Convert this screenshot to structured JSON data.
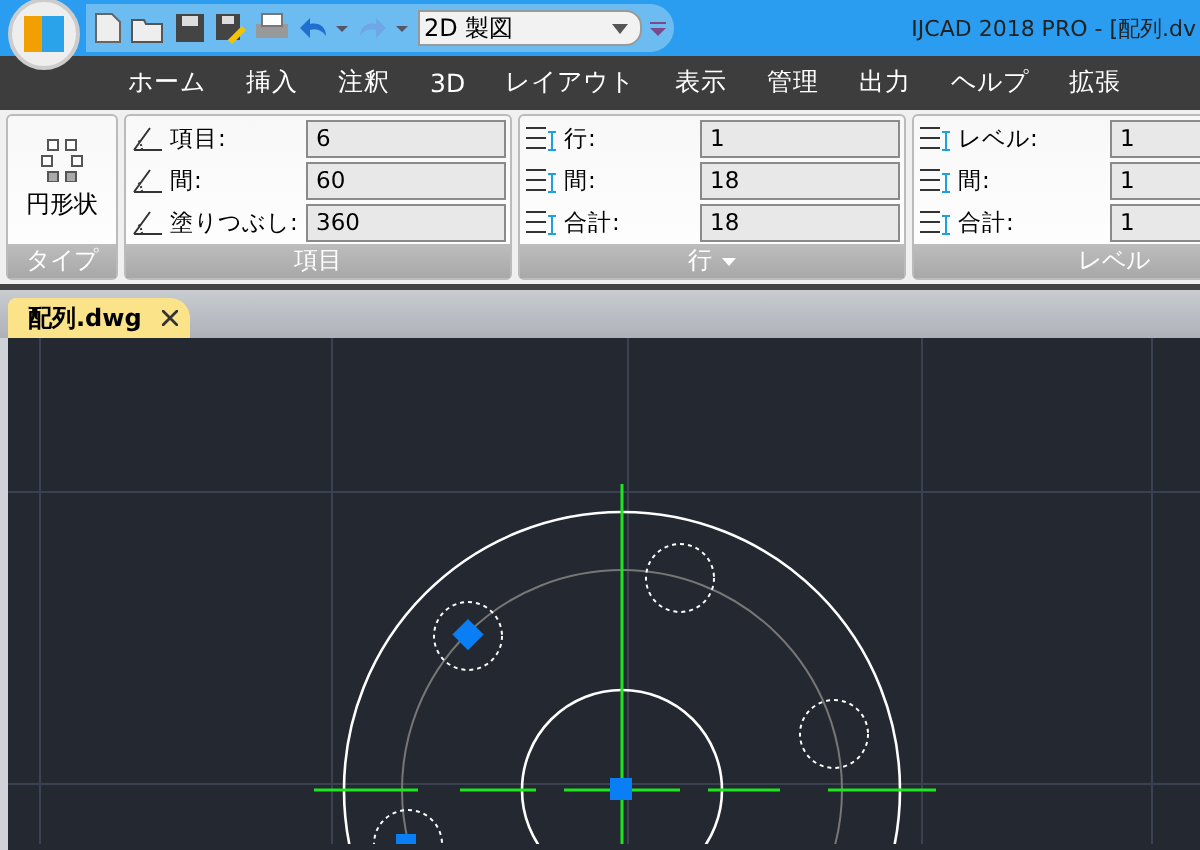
{
  "window": {
    "title": "IJCAD 2018 PRO - [配列.dv"
  },
  "quick_access": {
    "workspace": "2D 製図"
  },
  "menu": [
    {
      "label": "ホーム",
      "selected": false
    },
    {
      "label": "挿入",
      "selected": false
    },
    {
      "label": "注釈",
      "selected": false
    },
    {
      "label": "3D",
      "selected": false
    },
    {
      "label": "レイアウト",
      "selected": false
    },
    {
      "label": "表示",
      "selected": false
    },
    {
      "label": "管理",
      "selected": false
    },
    {
      "label": "出力",
      "selected": false
    },
    {
      "label": "ヘルプ",
      "selected": false
    },
    {
      "label": "拡張",
      "selected": false
    }
  ],
  "ribbon": [
    {
      "kind": "button",
      "title": "タイプ",
      "label": "円形状"
    },
    {
      "kind": "fields",
      "title": "項目",
      "expander": false,
      "rows": [
        {
          "label": "項目:",
          "value": "6"
        },
        {
          "label": "間:",
          "value": "60"
        },
        {
          "label": "塗りつぶし:",
          "value": "360"
        }
      ]
    },
    {
      "kind": "fields",
      "title": "行",
      "expander": true,
      "rows": [
        {
          "label": "行:",
          "value": "1"
        },
        {
          "label": "間:",
          "value": "18"
        },
        {
          "label": "合計:",
          "value": "18"
        }
      ]
    },
    {
      "kind": "fields",
      "title": "レベル",
      "expander": false,
      "rows": [
        {
          "label": "レベル:",
          "value": "1"
        },
        {
          "label": "間:",
          "value": "1"
        },
        {
          "label": "合計:",
          "value": "1"
        }
      ]
    }
  ],
  "document_tabs": [
    {
      "label": "配列.dwg",
      "selected": true
    }
  ]
}
